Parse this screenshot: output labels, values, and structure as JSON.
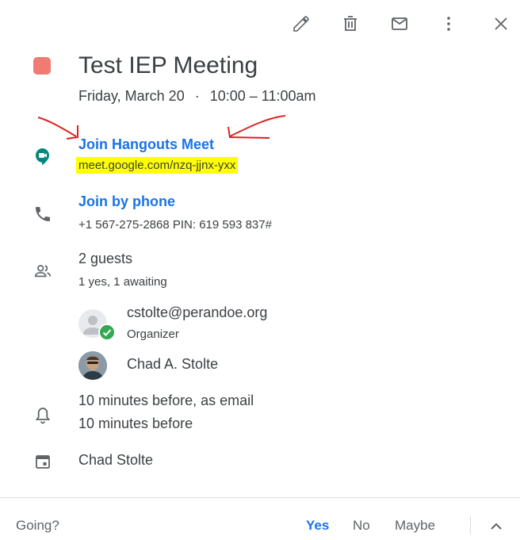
{
  "event": {
    "title": "Test IEP Meeting",
    "date": "Friday, March 20",
    "separator": "·",
    "time": "10:00 – 11:00am",
    "color": "#f07b72"
  },
  "toolbar": {
    "edit": "pencil-icon",
    "delete": "trash-icon",
    "email": "mail-icon",
    "more": "more-vert-icon",
    "close": "close-icon"
  },
  "meet": {
    "label": "Join Hangouts Meet",
    "url": "meet.google.com/nzq-jjnx-yxx"
  },
  "phone": {
    "label": "Join by phone",
    "details": "+1 567-275-2868 PIN: 619 593 837#"
  },
  "guests": {
    "summary": "2 guests",
    "status": "1 yes, 1 awaiting",
    "list": [
      {
        "name": "cstolte@perandoe.org",
        "role": "Organizer"
      },
      {
        "name": "Chad A. Stolte"
      }
    ]
  },
  "reminders": [
    "10 minutes before, as email",
    "10 minutes before"
  ],
  "calendar": {
    "owner": "Chad Stolte"
  },
  "footer": {
    "question": "Going?",
    "yes": "Yes",
    "no": "No",
    "maybe": "Maybe",
    "accent": "#1a73e8"
  }
}
